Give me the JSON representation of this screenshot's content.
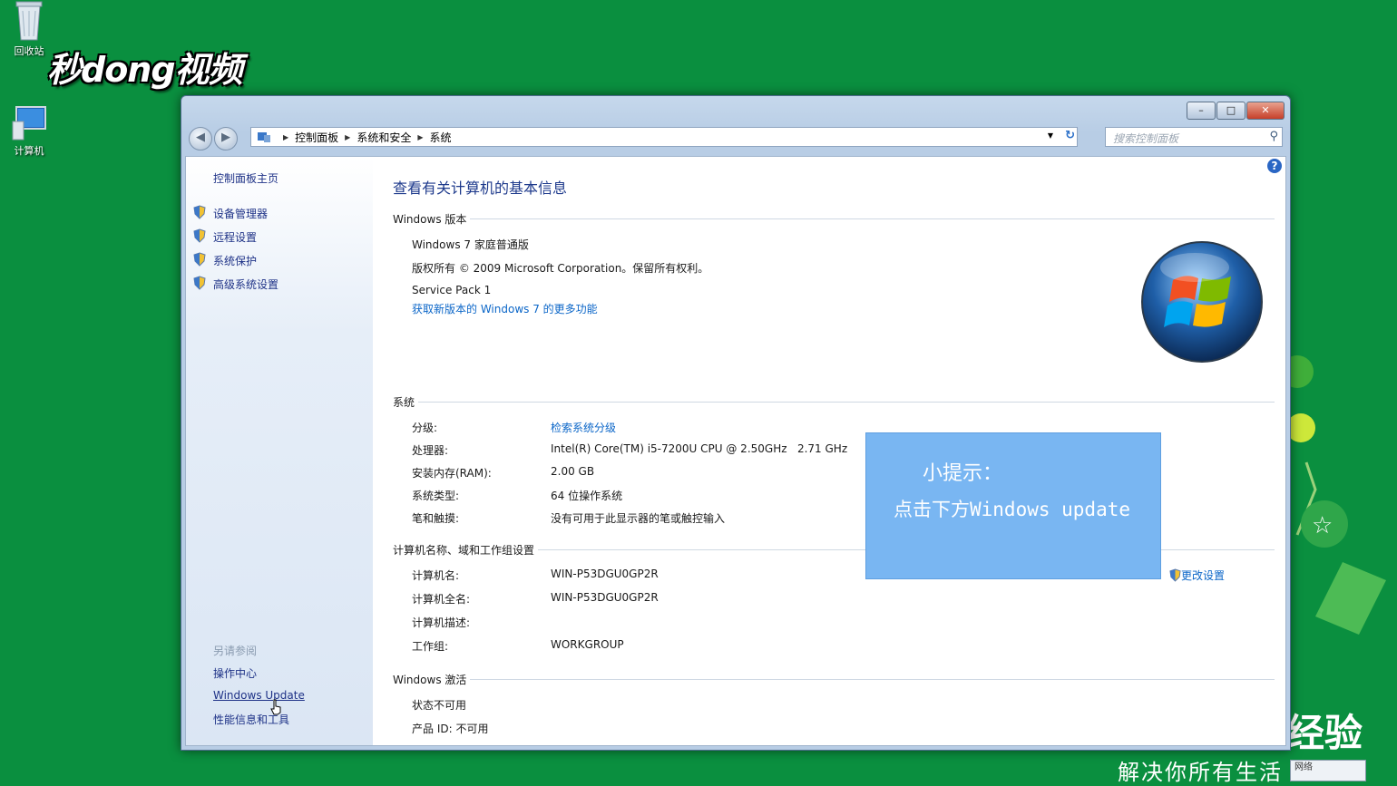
{
  "desktop": {
    "recycle_bin_label": "回收站",
    "computer_label": "计算机",
    "watermark": "秒dong视频",
    "slogan": "解决你所有生活",
    "jingyan": "经验",
    "tray_text": "网络"
  },
  "window": {
    "breadcrumb": [
      "控制面板",
      "系统和安全",
      "系统"
    ],
    "search_placeholder": "搜索控制面板",
    "caption_buttons": {
      "minimize": "–",
      "maximize": "□",
      "close": "✕"
    }
  },
  "sidebar": {
    "home": "控制面板主页",
    "items": [
      {
        "label": "设备管理器",
        "icon": "shield-icon"
      },
      {
        "label": "远程设置",
        "icon": "shield-icon"
      },
      {
        "label": "系统保护",
        "icon": "shield-icon"
      },
      {
        "label": "高级系统设置",
        "icon": "shield-icon"
      }
    ],
    "see_also": "另请参阅",
    "see_also_items": [
      "操作中心",
      "Windows Update",
      "性能信息和工具"
    ]
  },
  "main": {
    "title": "查看有关计算机的基本信息",
    "edition_section": "Windows 版本",
    "edition": "Windows 7 家庭普通版",
    "copyright": "版权所有 © 2009 Microsoft Corporation。保留所有权利。",
    "service_pack": "Service Pack 1",
    "more_features_link": "获取新版本的 Windows 7 的更多功能",
    "system_section": "系统",
    "system_rows": [
      {
        "label": "分级:",
        "value": "检索系统分级",
        "is_link": true
      },
      {
        "label": "处理器:",
        "value": "Intel(R) Core(TM) i5-7200U CPU @ 2.50GHz   2.71 GHz"
      },
      {
        "label": "安装内存(RAM):",
        "value": "2.00 GB"
      },
      {
        "label": "系统类型:",
        "value": "64 位操作系统"
      },
      {
        "label": "笔和触摸:",
        "value": "没有可用于此显示器的笔或触控输入"
      }
    ],
    "computer_section": "计算机名称、域和工作组设置",
    "change_settings": "更改设置",
    "computer_rows": [
      {
        "label": "计算机名:",
        "value": "WIN-P53DGU0GP2R"
      },
      {
        "label": "计算机全名:",
        "value": "WIN-P53DGU0GP2R"
      },
      {
        "label": "计算机描述:",
        "value": ""
      },
      {
        "label": "工作组:",
        "value": "WORKGROUP"
      }
    ],
    "activation_section": "Windows 激活",
    "activation_status": "状态不可用",
    "product_id": "产品 ID: 不可用"
  },
  "tip": {
    "title": "小提示：",
    "text": "点击下方Windows update"
  },
  "colors": {
    "desktop_bg": "#0a8f3f",
    "link": "#0b66c8",
    "tip_bg": "#79b6f2"
  }
}
